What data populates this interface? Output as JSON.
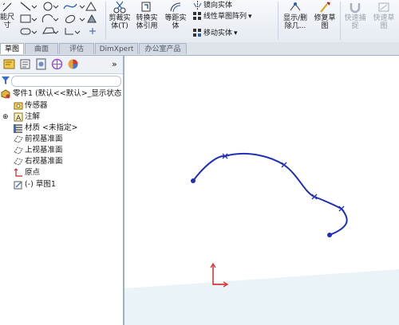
{
  "ribbon": {
    "smart_dim_label": "能尺\n寸",
    "trim_label": "剪裁实\n体(T)",
    "convert_label": "转换实\n体引用",
    "offset_label": "等距实\n体",
    "mirror_label": "镜向实体",
    "linear_pattern_label": "线性草图阵列",
    "move_label": "移动实体",
    "display_delete_label": "显示/删\n除几...",
    "repair_label": "修复草\n图",
    "quick_snap_label": "快速捕\n捉",
    "rapid_sketch_label": "快速草\n图"
  },
  "tabs": [
    {
      "label": "草图",
      "active": true
    },
    {
      "label": "曲面",
      "active": false
    },
    {
      "label": "评估",
      "active": false
    },
    {
      "label": "DimXpert",
      "active": false
    },
    {
      "label": "办公室产品",
      "active": false
    }
  ],
  "panel": {
    "expand_label": "»",
    "tree": {
      "root": "零件1  (默认<<默认>_显示状态",
      "sensors": "传感器",
      "annotations": "注解",
      "material": "材质 <未指定>",
      "front_plane": "前视基准面",
      "top_plane": "上视基准面",
      "right_plane": "右视基准面",
      "origin": "原点",
      "sketch": "(-)  草图1"
    }
  },
  "colors": {
    "spline": "#1f2fb8",
    "origin": "#d51a1a",
    "accent": "#2a5ea8"
  },
  "icons": {
    "trim": "scissors-icon",
    "mirror": "mirror-icon",
    "pattern": "grid-icon",
    "move": "move-icon",
    "snap": "magnet-icon"
  }
}
